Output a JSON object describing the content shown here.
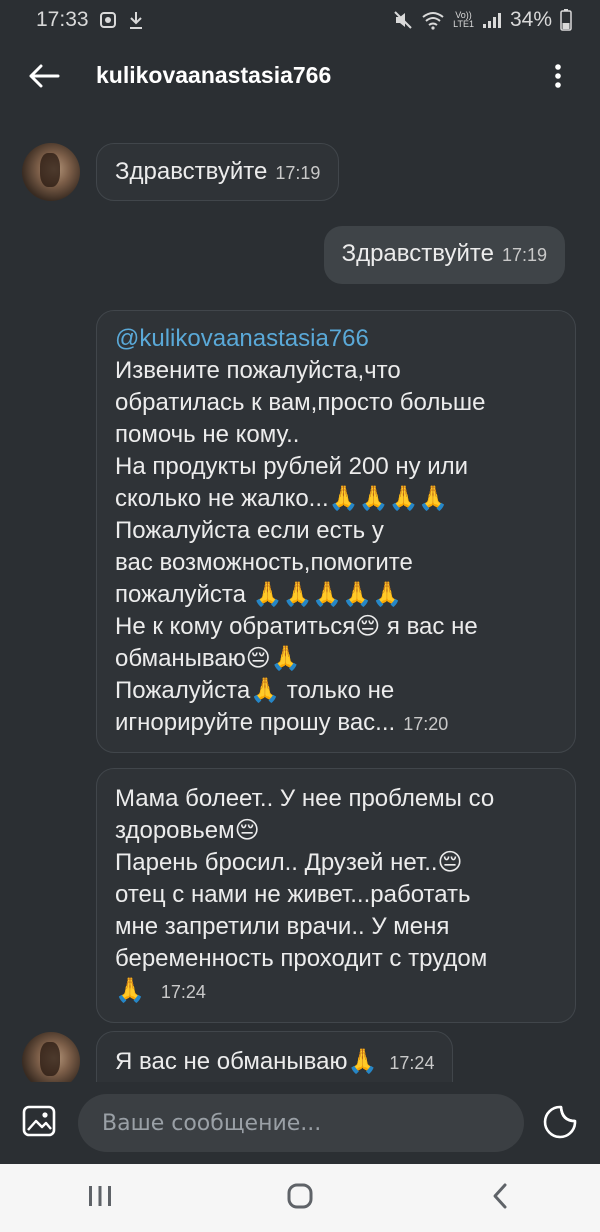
{
  "status_bar": {
    "time": "17:33",
    "network": "LTE1",
    "volte": "Vo))",
    "battery": "34%"
  },
  "header": {
    "title": "kulikovaanastasia766"
  },
  "messages": [
    {
      "direction": "in",
      "text": "Здравствуйте",
      "time": "17:19"
    },
    {
      "direction": "out",
      "text": "Здравствуйте",
      "time": "17:19"
    },
    {
      "direction": "in",
      "mention": "@kulikovaanastasia766",
      "lines": [
        "Извените пожалуйста,что",
        "обратилась к вам,просто больше",
        "помочь не кому..",
        "На продукты рублей 200 ну или",
        "сколько не жалко...🙏🙏🙏🙏",
        "Пожалуйста если есть у",
        "вас возможность,помогите",
        "пожалуйста 🙏🙏🙏🙏🙏",
        "Не к кому обратиться😔 я вас не",
        "обманываю😔🙏",
        "Пожалуйста🙏 только не",
        "игнорируйте прошу вас..."
      ],
      "time": "17:20"
    },
    {
      "direction": "in",
      "lines": [
        "Мама болеет.. У нее проблемы со",
        "здоровьем😔",
        "Парень бросил.. Друзей нет..😔",
        "отец с нами не живет...работать",
        "мне запретили врачи.. У меня",
        "беременность проходит с трудом",
        "🙏"
      ],
      "time": "17:24"
    },
    {
      "direction": "in",
      "text": "Я вас не обманываю🙏",
      "time": "17:24"
    }
  ],
  "composer": {
    "placeholder": "Ваше сообщение..."
  },
  "icons": {
    "back": "arrow-left-icon",
    "more": "more-vertical-icon",
    "gallery": "image-icon",
    "sticker": "sticker-icon"
  }
}
